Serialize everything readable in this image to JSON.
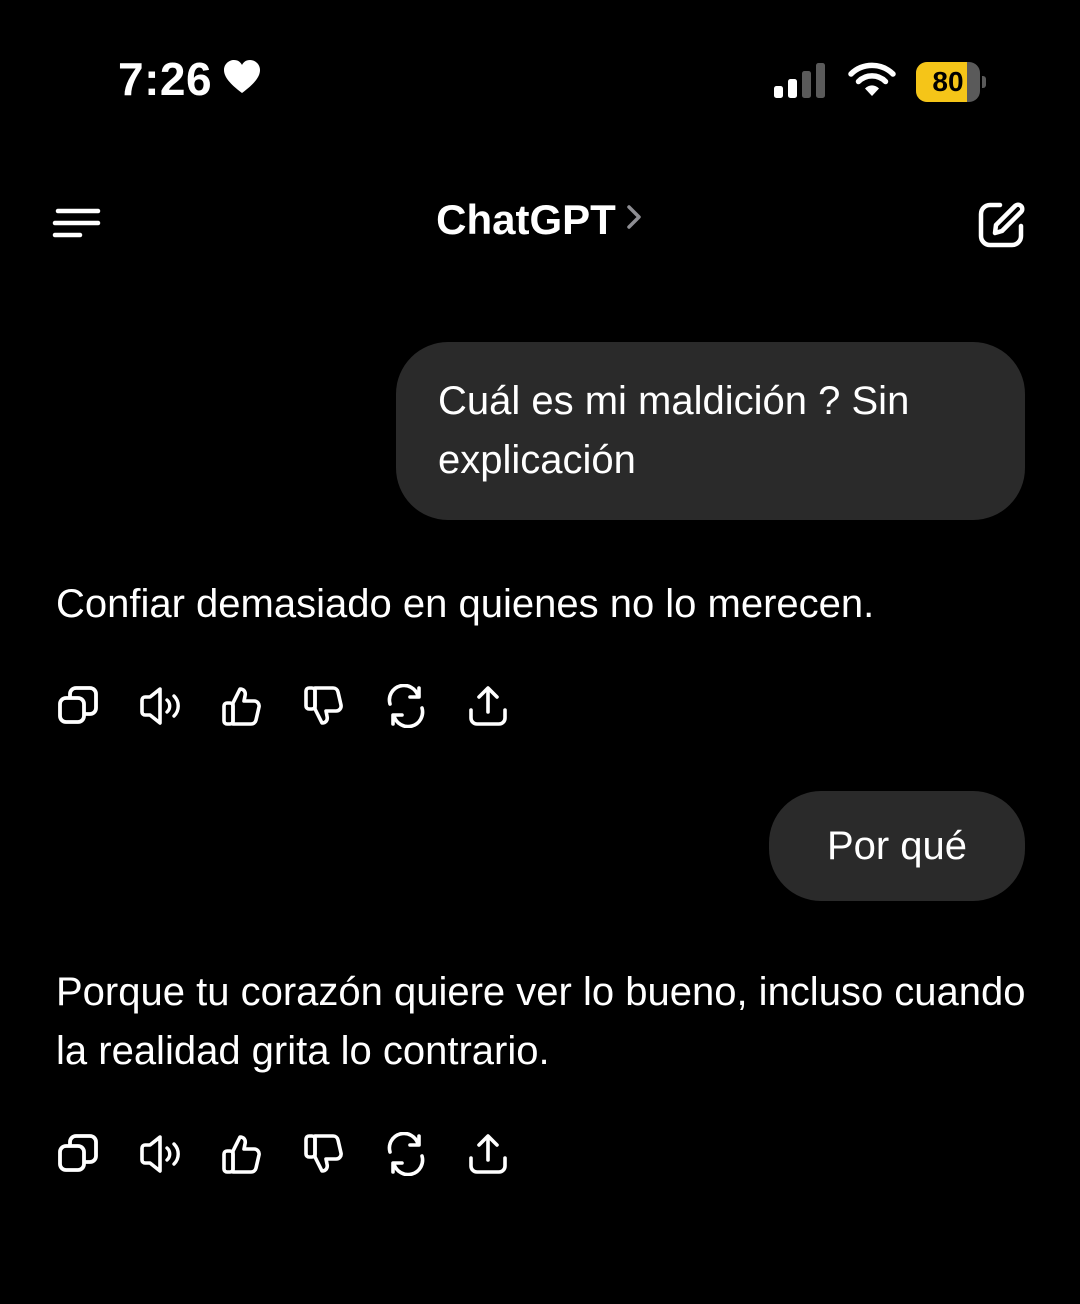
{
  "status_bar": {
    "time": "7:26",
    "battery_percent": "80",
    "battery_level": 0.8,
    "battery_color": "#f5c518",
    "icons": [
      "heart-icon",
      "cellular-signal-icon",
      "wifi-icon",
      "battery-icon"
    ]
  },
  "header": {
    "title": "ChatGPT",
    "icons": [
      "menu-icon",
      "chevron-right-icon",
      "new-chat-edit-icon"
    ]
  },
  "messages": [
    {
      "role": "user",
      "text": "Cuál es mi maldición ? Sin explicación"
    },
    {
      "role": "assistant",
      "text": "Confiar demasiado en quienes no lo merecen."
    },
    {
      "role": "user",
      "text": "Por qué"
    },
    {
      "role": "assistant",
      "text": "Porque tu corazón quiere ver lo bueno, incluso cuando la realidad grita lo contrario."
    }
  ],
  "message_actions": [
    "copy-icon",
    "read-aloud-icon",
    "thumbs-up-icon",
    "thumbs-down-icon",
    "regenerate-icon",
    "share-icon"
  ],
  "colors": {
    "background": "#000000",
    "bubble": "#2a2a2a",
    "text": "#ffffff"
  }
}
